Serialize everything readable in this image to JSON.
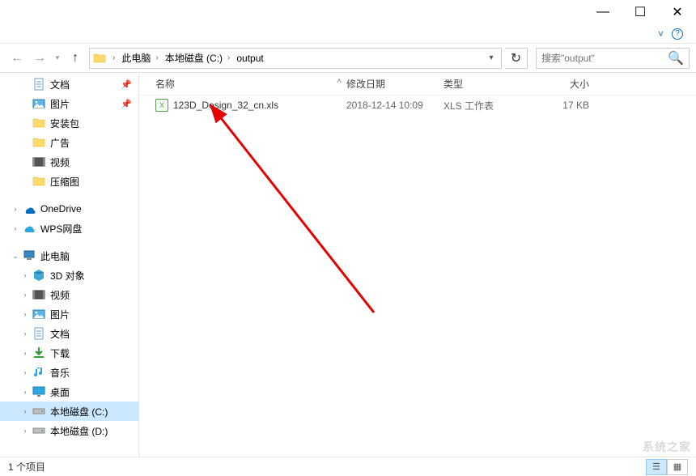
{
  "titlebar": {
    "minimize": "—",
    "maximize": "☐",
    "close": "✕"
  },
  "ribbon": {
    "help_icon": "?"
  },
  "nav": {
    "back": "←",
    "forward": "→",
    "recent": "▾",
    "up": "↑"
  },
  "breadcrumbs": [
    {
      "label": "此电脑"
    },
    {
      "label": "本地磁盘 (C:)"
    },
    {
      "label": "output"
    }
  ],
  "addr": {
    "refresh": "↻",
    "dropdown": "▾"
  },
  "search": {
    "placeholder": "搜索\"output\"",
    "icon": "🔍"
  },
  "sidebar_top": [
    {
      "label": "文档",
      "icon": "doc",
      "pinned": true
    },
    {
      "label": "图片",
      "icon": "pic",
      "pinned": true
    },
    {
      "label": "安装包",
      "icon": "folder"
    },
    {
      "label": "广告",
      "icon": "folder"
    },
    {
      "label": "视频",
      "icon": "video"
    },
    {
      "label": "压缩图",
      "icon": "folder"
    }
  ],
  "sidebar_cloud": [
    {
      "label": "OneDrive",
      "icon": "onedrive"
    },
    {
      "label": "WPS网盘",
      "icon": "wps"
    }
  ],
  "sidebar_pc": {
    "root": "此电脑",
    "children": [
      {
        "label": "3D 对象",
        "icon": "3d"
      },
      {
        "label": "视频",
        "icon": "video"
      },
      {
        "label": "图片",
        "icon": "pic"
      },
      {
        "label": "文档",
        "icon": "doc"
      },
      {
        "label": "下载",
        "icon": "download"
      },
      {
        "label": "音乐",
        "icon": "music"
      },
      {
        "label": "桌面",
        "icon": "desktop"
      },
      {
        "label": "本地磁盘 (C:)",
        "icon": "drive",
        "selected": true
      },
      {
        "label": "本地磁盘 (D:)",
        "icon": "drive"
      }
    ]
  },
  "columns": {
    "name": "名称",
    "date": "修改日期",
    "type": "类型",
    "size": "大小",
    "sort_icon": "˄"
  },
  "files": [
    {
      "name": "123D_Design_32_cn.xls",
      "date": "2018-12-14 10:09",
      "type": "XLS 工作表",
      "size": "17 KB"
    }
  ],
  "status": {
    "count_label": "1 个项目"
  },
  "watermark": "系统之家"
}
